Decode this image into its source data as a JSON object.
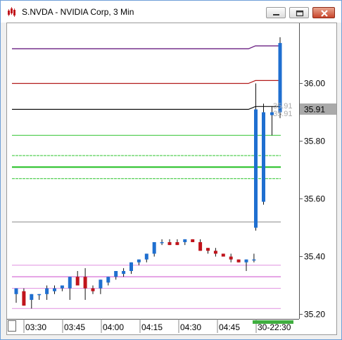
{
  "window": {
    "title": "S.NVDA - NVIDIA Corp, 3 Min",
    "icons": {
      "app": "chart-app-icon",
      "minimize": "minimize-icon",
      "maximize": "maximize-icon",
      "close": "close-icon"
    }
  },
  "chart_data": {
    "type": "candlestick",
    "title": "",
    "xlabel": "",
    "ylabel": "",
    "ylim": [
      35.17,
      35.98
    ],
    "y_ticks": [
      "36.00",
      "35.80",
      "35.60",
      "35.40",
      "35.20"
    ],
    "x_ticks": [
      "03:30",
      "03:45",
      "04:00",
      "04:15",
      "04:30",
      "04:45",
      "30-22:30"
    ],
    "last_price_label": "35.91",
    "current_price_annotations": [
      "35.91",
      "35.91"
    ],
    "colors": {
      "up": "#1f6fd0",
      "down": "#c0141c"
    },
    "candles": [
      {
        "o": 35.27,
        "h": 35.29,
        "l": 35.24,
        "c": 35.29
      },
      {
        "o": 35.28,
        "h": 35.29,
        "l": 35.23,
        "c": 35.23
      },
      {
        "o": 35.25,
        "h": 35.27,
        "l": 35.22,
        "c": 35.27
      },
      {
        "o": 35.27,
        "h": 35.27,
        "l": 35.25,
        "c": 35.27
      },
      {
        "o": 35.27,
        "h": 35.3,
        "l": 35.25,
        "c": 35.29
      },
      {
        "o": 35.28,
        "h": 35.3,
        "l": 35.27,
        "c": 35.29
      },
      {
        "o": 35.29,
        "h": 35.3,
        "l": 35.28,
        "c": 35.3
      },
      {
        "o": 35.29,
        "h": 35.33,
        "l": 35.25,
        "c": 35.33
      },
      {
        "o": 35.33,
        "h": 35.35,
        "l": 35.3,
        "c": 35.3
      },
      {
        "o": 35.33,
        "h": 35.36,
        "l": 35.25,
        "c": 35.29
      },
      {
        "o": 35.29,
        "h": 35.3,
        "l": 35.27,
        "c": 35.28
      },
      {
        "o": 35.29,
        "h": 35.32,
        "l": 35.27,
        "c": 35.32
      },
      {
        "o": 35.31,
        "h": 35.33,
        "l": 35.3,
        "c": 35.33
      },
      {
        "o": 35.33,
        "h": 35.35,
        "l": 35.32,
        "c": 35.35
      },
      {
        "o": 35.34,
        "h": 35.36,
        "l": 35.33,
        "c": 35.35
      },
      {
        "o": 35.35,
        "h": 35.38,
        "l": 35.34,
        "c": 35.38
      },
      {
        "o": 35.38,
        "h": 35.39,
        "l": 35.37,
        "c": 35.39
      },
      {
        "o": 35.39,
        "h": 35.41,
        "l": 35.38,
        "c": 35.41
      },
      {
        "o": 35.41,
        "h": 35.45,
        "l": 35.4,
        "c": 35.45
      },
      {
        "o": 35.45,
        "h": 35.46,
        "l": 35.44,
        "c": 35.45
      },
      {
        "o": 35.45,
        "h": 35.46,
        "l": 35.44,
        "c": 35.44
      },
      {
        "o": 35.45,
        "h": 35.46,
        "l": 35.44,
        "c": 35.44
      },
      {
        "o": 35.45,
        "h": 35.46,
        "l": 35.44,
        "c": 35.46
      },
      {
        "o": 35.46,
        "h": 35.46,
        "l": 35.45,
        "c": 35.45
      },
      {
        "o": 35.45,
        "h": 35.46,
        "l": 35.42,
        "c": 35.42
      },
      {
        "o": 35.43,
        "h": 35.43,
        "l": 35.41,
        "c": 35.42
      },
      {
        "o": 35.42,
        "h": 35.43,
        "l": 35.4,
        "c": 35.41
      },
      {
        "o": 35.41,
        "h": 35.41,
        "l": 35.4,
        "c": 35.4
      },
      {
        "o": 35.4,
        "h": 35.41,
        "l": 35.38,
        "c": 35.39
      },
      {
        "o": 35.39,
        "h": 35.39,
        "l": 35.38,
        "c": 35.38
      },
      {
        "o": 35.38,
        "h": 35.39,
        "l": 35.35,
        "c": 35.39
      },
      {
        "o": 35.39,
        "h": 35.41,
        "l": 35.38,
        "c": 35.39
      }
    ],
    "session_candles": [
      {
        "o": 35.5,
        "h": 36.0,
        "l": 35.49,
        "c": 35.91
      },
      {
        "o": 35.59,
        "h": 35.93,
        "l": 35.58,
        "c": 35.9
      },
      {
        "o": 35.89,
        "h": 35.92,
        "l": 35.82,
        "c": 35.9
      },
      {
        "o": 35.9,
        "h": 36.01,
        "l": 35.88,
        "c": 36.0
      },
      {
        "o": 35.97,
        "h": 36.16,
        "l": 35.97,
        "c": 36.14
      }
    ],
    "levels": [
      {
        "price": 36.12,
        "session_price": 36.13,
        "color": "#6b2083",
        "style": "solid",
        "width": 1.3
      },
      {
        "price": 36.0,
        "session_price": 36.01,
        "color": "#b21c1c",
        "style": "solid",
        "width": 1.2
      },
      {
        "price": 35.91,
        "session_price": 35.92,
        "color": "#111111",
        "style": "solid",
        "width": 1.2
      },
      {
        "price": 35.82,
        "session_price": 35.82,
        "color": "#2ec42e",
        "style": "solid",
        "width": 1
      },
      {
        "price": 35.75,
        "session_price": 35.75,
        "color": "#2ec42e",
        "style": "dash",
        "width": 1
      },
      {
        "price": 35.71,
        "session_price": 35.71,
        "color": "#1fbf1f",
        "style": "solid",
        "width": 2
      },
      {
        "price": 35.67,
        "session_price": 35.67,
        "color": "#2ec42e",
        "style": "dash",
        "width": 1
      },
      {
        "price": 35.52,
        "session_price": 35.52,
        "color": "#8a8a8a",
        "style": "solid",
        "width": 1
      },
      {
        "price": 35.37,
        "session_price": 35.37,
        "color": "#e090e0",
        "style": "solid",
        "width": 1
      },
      {
        "price": 35.33,
        "session_price": 35.33,
        "color": "#e090e0",
        "style": "solid",
        "width": 1.6
      },
      {
        "price": 35.29,
        "session_price": 35.29,
        "color": "#e090e0",
        "style": "solid",
        "width": 1
      },
      {
        "price": 35.22,
        "session_price": 35.22,
        "color": "#e090e0",
        "style": "solid",
        "width": 1
      }
    ]
  }
}
